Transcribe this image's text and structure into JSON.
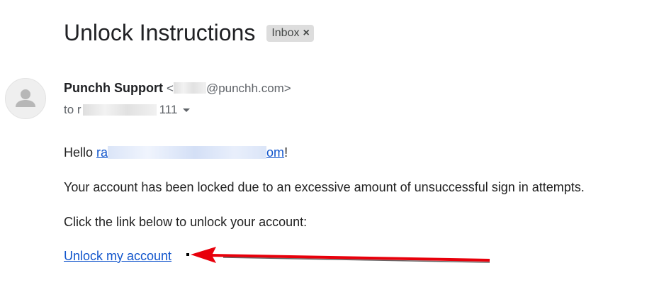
{
  "email": {
    "subject": "Unlock Instructions",
    "label_chip": {
      "text": "Inbox",
      "close_glyph": "×"
    },
    "sender": {
      "name": "Punchh Support",
      "email_prefix": "<",
      "email_suffix": "@punchh.com>",
      "avatar_icon": "person-icon"
    },
    "recipient": {
      "to_label": "to r",
      "tail": "111",
      "details_icon": "caret-down-icon"
    },
    "body": {
      "hello_prefix": "Hello ",
      "hello_link_start": "ra",
      "hello_link_end": "om",
      "hello_suffix": "!",
      "line1": "Your account has been locked due to an excessive amount of unsuccessful sign in attempts.",
      "line2": "Click the link below to unlock your account:",
      "unlock_link": "Unlock my account"
    },
    "annotation": {
      "arrow_color": "#e8000b"
    }
  }
}
